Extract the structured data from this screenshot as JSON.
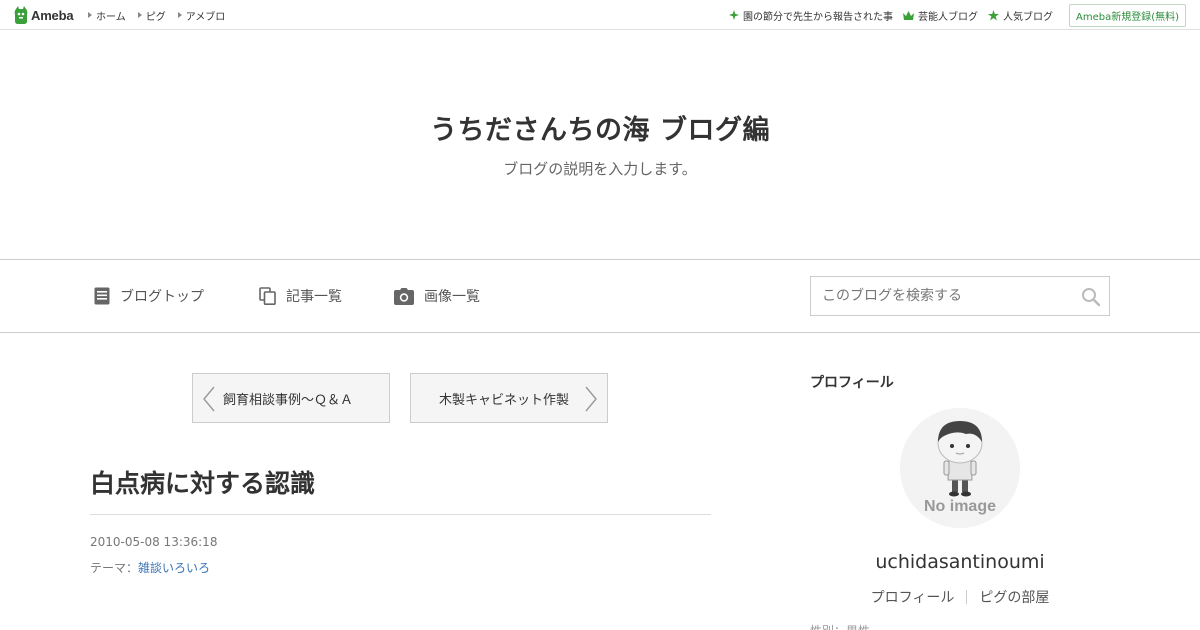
{
  "topbar": {
    "logo_text": "Ameba",
    "links": [
      {
        "label": "ホーム"
      },
      {
        "label": "ピグ"
      },
      {
        "label": "アメブロ"
      }
    ],
    "right_links": [
      {
        "label": "園の節分で先生から報告された事",
        "icon": "sparkle-icon"
      },
      {
        "label": "芸能人ブログ",
        "icon": "crown-icon"
      },
      {
        "label": "人気ブログ",
        "icon": "star-icon"
      }
    ],
    "register_label": "Ameba新規登録(無料)"
  },
  "header": {
    "title": "うちださんちの海 ブログ編",
    "description": "ブログの説明を入力します。"
  },
  "nav": {
    "items": [
      {
        "label": "ブログトップ",
        "icon": "document-icon"
      },
      {
        "label": "記事一覧",
        "icon": "copy-icon"
      },
      {
        "label": "画像一覧",
        "icon": "camera-icon"
      }
    ],
    "search_placeholder": "このブログを検索する"
  },
  "entry": {
    "prev_label": "飼育相談事例～Ｑ＆Ａ",
    "next_label": "木製キャビネット作製",
    "title": "白点病に対する認識",
    "date": "2010-05-08 13:36:18",
    "theme_prefix": "テーマ：",
    "theme": "雑談いろいろ"
  },
  "sidebar": {
    "heading": "プロフィール",
    "avatar_text": "No image",
    "username": "uchidasantinoumi",
    "links": [
      {
        "label": "プロフィール"
      },
      {
        "label": "ピグの部屋"
      }
    ],
    "next_partial": "性別：男性"
  },
  "colors": {
    "accent_green": "#2d8c3c",
    "link_blue": "#3a74b5",
    "border": "#cccccc"
  }
}
